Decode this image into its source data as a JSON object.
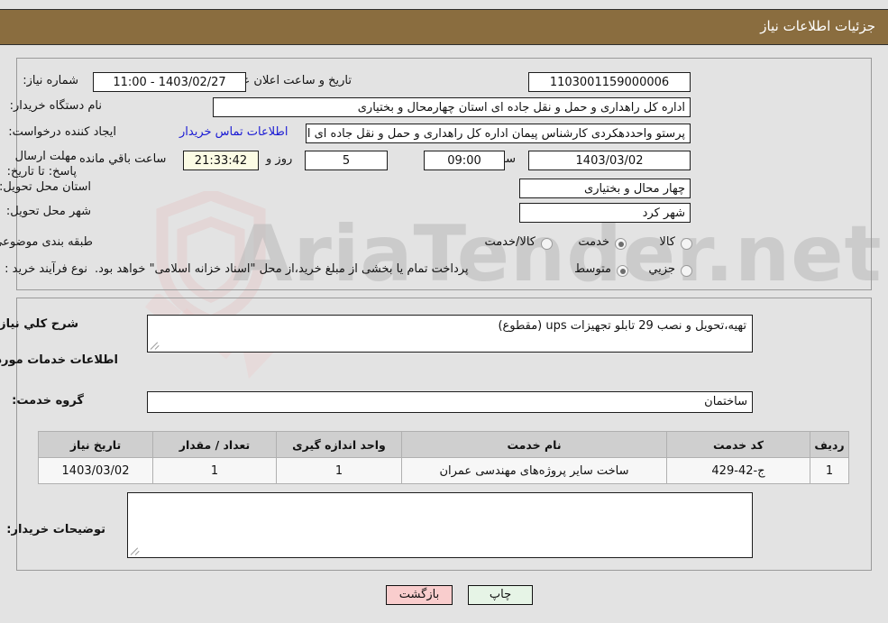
{
  "header": {
    "title": "جزئیات اطلاعات نیاز",
    "bg_color": "#8a6d3f"
  },
  "watermark": {
    "text": "AriaTender.net"
  },
  "top_form": {
    "labels": {
      "need_number": "شماره نیاز:",
      "buyer_org": "نام دستگاه خریدار:",
      "request_creator": "ایجاد کننده درخواست:",
      "deadline": "مهلت ارسال پاسخ: تا تاریخ:",
      "delivery_province": "استان محل تحویل:",
      "delivery_city": "شهر محل تحویل:",
      "subject_category": "طبقه بندی موضوعی:",
      "purchase_process": "نوع فرآیند خرید :",
      "public_announce": "تاریخ و ساعت اعلان عمومي:",
      "hour": "ساعت",
      "days_and": "روز و",
      "hours_remaining": "ساعت باقي مانده"
    },
    "values": {
      "need_number": "1103001159000006",
      "buyer_org": "اداره کل راهداری و حمل و نقل جاده ای استان چهارمحال و بختیاری",
      "request_creator": "پرستو واحددهکردی کارشناس پیمان اداره کل راهداری و حمل و نقل جاده ای اس",
      "contact_link": "اطلاعات تماس خریدار",
      "deadline_date": "1403/03/02",
      "deadline_time": "09:00",
      "days_left": "5",
      "time_left": "21:33:42",
      "public_announce": "1403/02/27 - 11:00",
      "delivery_province": "چهار محال و بختیاری",
      "delivery_city": "شهر کرد"
    },
    "subject_options": [
      {
        "label": "کالا",
        "selected": false
      },
      {
        "label": "خدمت",
        "selected": true
      },
      {
        "label": "کالا/خدمت",
        "selected": false
      }
    ],
    "process_options": [
      {
        "label": "جزیي",
        "selected": false
      },
      {
        "label": "متوسط",
        "selected": true
      }
    ],
    "payment_note": "پرداخت تمام یا بخشی از مبلغ خرید،از محل \"اسناد خزانه اسلامی\" خواهد بود."
  },
  "bottom": {
    "need_summary_label": "شرح کلي نیاز:",
    "need_summary_value": "تهیه،تحویل و نصب 29 تابلو تجهیزات ups (مقطوع)",
    "services_heading": "اطلاعات خدمات مورد نیاز",
    "service_group_label": "گروه خدمت:",
    "service_group_value": "ساختمان",
    "buyer_notes_label": "توضیحات خریدار:",
    "buyer_notes_value": ""
  },
  "table": {
    "headers": [
      "ردیف",
      "کد خدمت",
      "نام خدمت",
      "واحد اندازه گیری",
      "تعداد / مقدار",
      "تاریخ نیاز"
    ],
    "rows": [
      {
        "row": "1",
        "code": "ج-42-429",
        "name": "ساخت سایر پروژه‌های مهندسی عمران",
        "unit": "1",
        "qty": "1",
        "date": "1403/03/02"
      }
    ]
  },
  "footer": {
    "print_label": "چاپ",
    "back_label": "بازگشت"
  }
}
